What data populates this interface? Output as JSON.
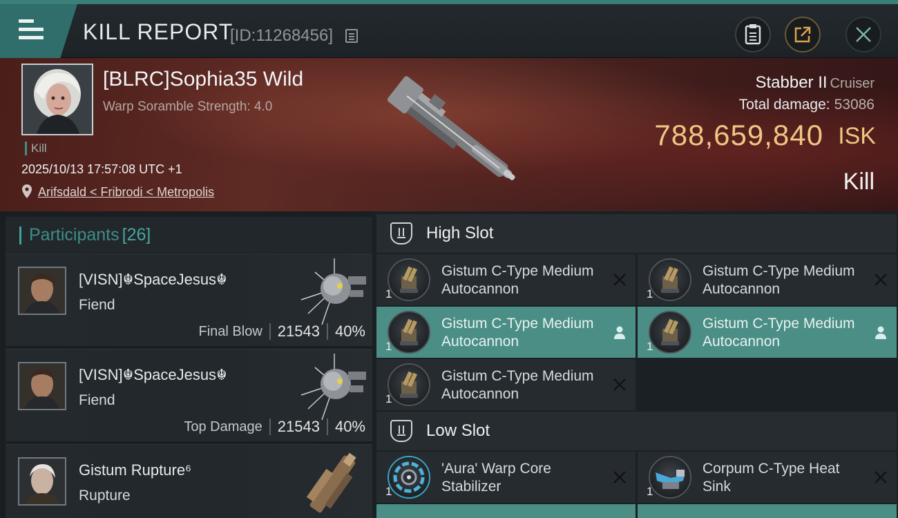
{
  "header": {
    "title": "KILL REPORT",
    "report_id": "[ID:11268456]"
  },
  "victim": {
    "name": "[BLRC]Sophia35 Wild",
    "scramble": "Warp Soramble Strength: 4.0",
    "tag": "Kill",
    "datetime": "2025/10/13 17:57:08 UTC +1",
    "location": "Arifsdald < Fribrodi < Metropolis",
    "ship": "Stabber II",
    "ship_class": "Cruiser",
    "damage_label": "Total damage:",
    "damage_value": "53086",
    "isk_value": "788,659,840",
    "isk_unit": "ISK",
    "kill_type": "Kill"
  },
  "participants": {
    "title": "Participants",
    "count": "[26]",
    "rows": [
      {
        "name": "[VISN]☬SpaceJesus☬",
        "ship": "Fiend",
        "label": "Final Blow",
        "damage": "21543",
        "percent": "40%"
      },
      {
        "name": "[VISN]☬SpaceJesus☬",
        "ship": "Fiend",
        "label": "Top Damage",
        "damage": "21543",
        "percent": "40%"
      },
      {
        "name": "Gistum Rupture⁶",
        "ship": "Rupture"
      }
    ]
  },
  "fitting": {
    "high_slot_title": "High Slot",
    "low_slot_title": "Low Slot",
    "high_slot": [
      {
        "name": "Gistum C-Type Medium Autocannon",
        "qty": "1",
        "status": "destroyed"
      },
      {
        "name": "Gistum C-Type Medium Autocannon",
        "qty": "1",
        "status": "destroyed"
      },
      {
        "name": "Gistum C-Type Medium Autocannon",
        "qty": "1",
        "status": "dropped"
      },
      {
        "name": "Gistum C-Type Medium Autocannon",
        "qty": "1",
        "status": "dropped"
      },
      {
        "name": "Gistum C-Type Medium Autocannon",
        "qty": "1",
        "status": "destroyed"
      }
    ],
    "low_slot": [
      {
        "name": "'Aura' Warp Core Stabilizer",
        "qty": "1",
        "status": "destroyed"
      },
      {
        "name": "Corpum C-Type Heat Sink",
        "qty": "1",
        "status": "destroyed"
      }
    ]
  },
  "colors": {
    "accent_teal": "#3f8d86",
    "isk_gold": "#f0c684",
    "dropped_highlight": "#4a8e86",
    "banner_red": "#4a1e1a"
  },
  "icons": {
    "menu": "hamburger-icon",
    "copy": "copy-icon",
    "clipboard": "clipboard-icon",
    "share": "share-icon",
    "close": "close-icon",
    "location": "location-pin-icon",
    "slot": "slot-shield-icon",
    "destroyed": "x-mark-icon",
    "dropped": "person-icon"
  }
}
